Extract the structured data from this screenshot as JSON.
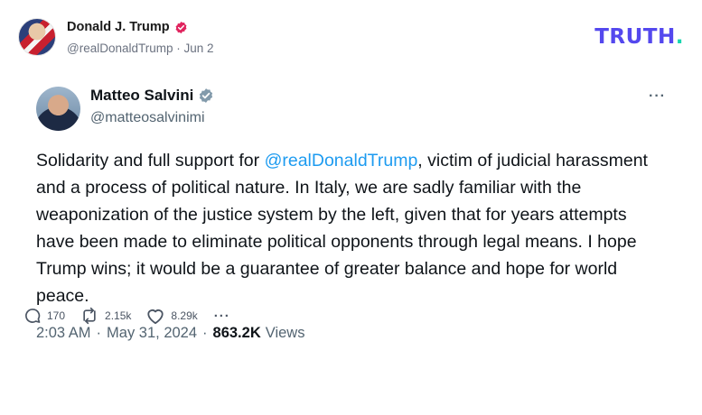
{
  "post": {
    "author_name": "Donald J. Trump",
    "author_handle": "@realDonaldTrump",
    "date_separator": "·",
    "date": "Jun 2",
    "brand": "TRUTH",
    "brand_dot": ".",
    "brand_color": "#5448ee",
    "brand_dot_color": "#17d6b0",
    "verified_color": "#e0245e"
  },
  "embedded_tweet": {
    "author_name": "Matteo Salvini",
    "author_handle": "@matteosalvinimi",
    "more_label": "···",
    "text_before": "Solidarity and full support for ",
    "mention": "@realDonaldTrump",
    "text_after": ", victim of judicial harassment and a process of political nature. In Italy, we are sadly familiar with the weaponization of the justice system by the left, given that for years attempts have been made to eliminate political opponents through legal means. I hope Trump wins; it would be a guarantee of greater balance and hope for world peace.",
    "time": "2:03 AM",
    "separator": "·",
    "date": "May 31, 2024",
    "views_count": "863.2K",
    "views_label": "Views",
    "mention_color": "#1d9bf0",
    "verified_color": "#829aab"
  },
  "actions": {
    "replies": "170",
    "retruths": "2.15k",
    "likes": "8.29k",
    "more_label": "···"
  }
}
